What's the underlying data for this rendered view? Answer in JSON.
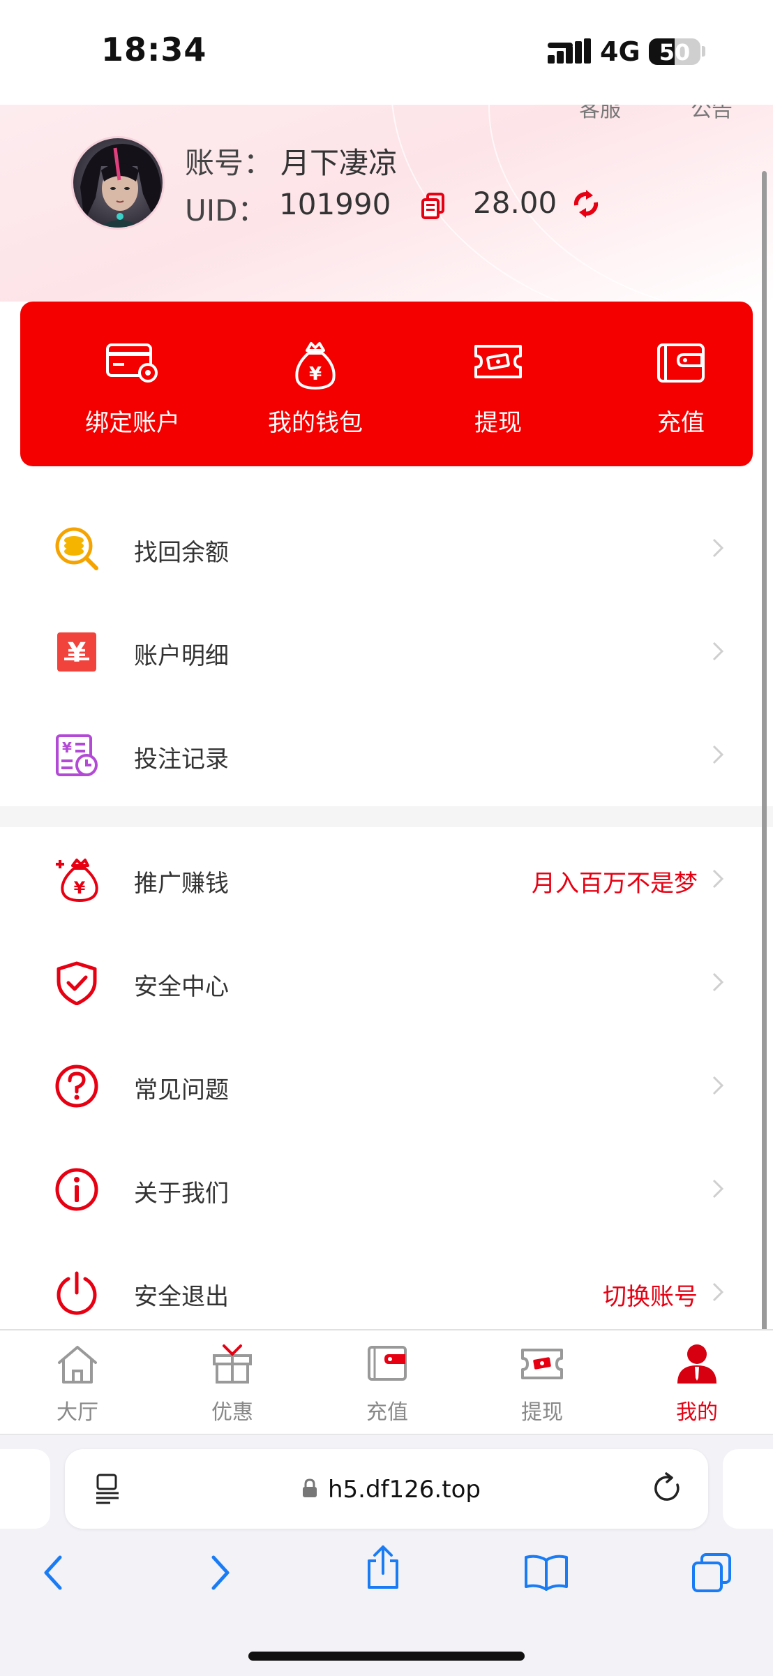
{
  "status_bar": {
    "time": "18:34",
    "network": "4G",
    "battery_level": "50",
    "battery_fraction": 0.5
  },
  "header": {
    "top_links": [
      "客服",
      "公告"
    ],
    "account_label": "账号：",
    "account_name": "月下凄凉",
    "uid_label": "UID：",
    "uid_value": "101990",
    "balance": "28.00"
  },
  "actions": [
    {
      "label": "绑定账户",
      "icon": "bank-card-gear-icon"
    },
    {
      "label": "我的钱包",
      "icon": "money-bag-icon"
    },
    {
      "label": "提现",
      "icon": "withdraw-ticket-icon"
    },
    {
      "label": "充值",
      "icon": "wallet-icon"
    }
  ],
  "menu": [
    {
      "label": "找回余额",
      "icon": "coin-search-icon",
      "extra": ""
    },
    {
      "label": "账户明细",
      "icon": "yuan-statement-icon",
      "extra": ""
    },
    {
      "label": "投注记录",
      "icon": "bet-record-icon",
      "extra": ""
    },
    {
      "label": "推广赚钱",
      "icon": "promote-money-bag-icon",
      "extra": "月入百万不是梦"
    },
    {
      "label": "安全中心",
      "icon": "shield-check-icon",
      "extra": ""
    },
    {
      "label": "常见问题",
      "icon": "question-icon",
      "extra": ""
    },
    {
      "label": "关于我们",
      "icon": "info-icon",
      "extra": ""
    },
    {
      "label": "安全退出",
      "icon": "power-icon",
      "extra": "切换账号"
    }
  ],
  "tabbar": [
    {
      "label": "大厅",
      "icon": "home-icon",
      "active": false
    },
    {
      "label": "优惠",
      "icon": "gift-icon",
      "active": false
    },
    {
      "label": "充值",
      "icon": "wallet-icon",
      "active": false
    },
    {
      "label": "提现",
      "icon": "withdraw-ticket-icon",
      "active": false
    },
    {
      "label": "我的",
      "icon": "user-icon",
      "active": true
    }
  ],
  "browser": {
    "url": "h5.df126.top"
  },
  "colors": {
    "brand_red": "#f50000",
    "accent_red": "#e60012",
    "inactive_gray": "#888888"
  }
}
